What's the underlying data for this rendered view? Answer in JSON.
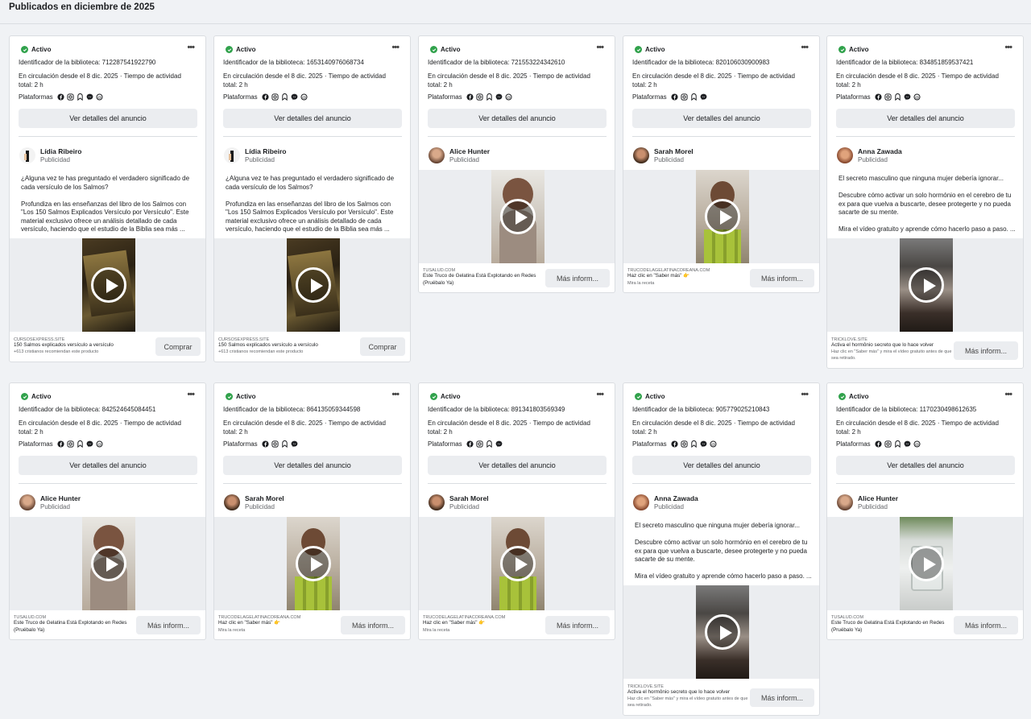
{
  "page": {
    "title": "Publicados en diciembre de 2025"
  },
  "common": {
    "status": "Activo",
    "more": "•••",
    "circulation": "En circulación desde el 8 dic. 2025 · Tiempo de actividad total: 2 h",
    "platforms_label": "Plataformas",
    "details_button": "Ver detalles del anuncio",
    "sponsored": "Publicidad"
  },
  "texts": {
    "salmos": "¿Alguna vez te has preguntado el verdadero significado de cada versículo de los Salmos?\n\nProfundiza en las enseñanzas del libro de los Salmos con \"Los 150 Salmos Explicados Versículo por Versículo\". Este material exclusivo ofrece un análisis detallado de cada versículo, haciendo que el estudio de la Biblia sea más ...",
    "secreto": "El secreto masculino que ninguna mujer debería ignorar...\n\nDescubre cómo activar un solo hormónio en el cerebro de tu ex para que vuelva a buscarte, desee protegerte y no pueda sacarte de su mente.\n\nMira el vídeo gratuito y aprende cómo hacerlo paso a paso. ..."
  },
  "cards": [
    {
      "library_id": "Identificador de la biblioteca: 712287541922790",
      "advertiser": "Lídia Ribeiro",
      "footer": {
        "domain": "CURSOSEXPRESS.SITE",
        "title": "150 Salmos explicados versículo a versículo",
        "desc": "+613 cristianos recomiendan este producto",
        "cta": "Comprar"
      }
    },
    {
      "library_id": "Identificador de la biblioteca: 1653140976068734",
      "advertiser": "Lídia Ribeiro",
      "footer": {
        "domain": "CURSOSEXPRESS.SITE",
        "title": "150 Salmos explicados versículo a versículo",
        "desc": "+613 cristianos recomiendan este producto",
        "cta": "Comprar"
      }
    },
    {
      "library_id": "Identificador de la biblioteca: 721553224342610",
      "advertiser": "Alice Hunter",
      "footer": {
        "domain": "TUSALUD.COM",
        "title": "Este Truco de Gelatina Está Explotando en Redes (Pruébalo Ya)",
        "desc": "",
        "cta": "Más inform..."
      }
    },
    {
      "library_id": "Identificador de la biblioteca: 820106030900983",
      "advertiser": "Sarah Morel",
      "footer": {
        "domain": "TRUCODELAGELATINACOREANA.COM",
        "title": "Haz clic en \"Saber más\" 👉",
        "desc": "Mira la receta",
        "cta": "Más inform..."
      }
    },
    {
      "library_id": "Identificador de la biblioteca: 834851859537421",
      "advertiser": "Anna Zawada",
      "footer": {
        "domain": "TRICKLOVE.SITE",
        "title": "Activa el hormônio secreto que lo hace volver",
        "desc": "Haz clic en \"Saber más\" y mira el vídeo gratuito antes de que sea retirado.",
        "cta": "Más inform..."
      }
    },
    {
      "library_id": "Identificador de la biblioteca: 842524645084451",
      "advertiser": "Alice Hunter",
      "footer": {
        "domain": "TUSALUD.COM",
        "title": "Este Truco de Gelatina Está Explotando en Redes (Pruébalo Ya)",
        "desc": "",
        "cta": "Más inform..."
      }
    },
    {
      "library_id": "Identificador de la biblioteca: 864135059344598",
      "advertiser": "Sarah Morel",
      "footer": {
        "domain": "TRUCODELAGELATINACOREANA.COM",
        "title": "Haz clic en \"Saber más\" 👉",
        "desc": "Mira la receta",
        "cta": "Más inform..."
      }
    },
    {
      "library_id": "Identificador de la biblioteca: 891341803569349",
      "advertiser": "Sarah Morel",
      "footer": {
        "domain": "TRUCODELAGELATINACOREANA.COM",
        "title": "Haz clic en \"Saber más\" 👉",
        "desc": "Mira la receta",
        "cta": "Más inform..."
      }
    },
    {
      "library_id": "Identificador de la biblioteca: 905779025210843",
      "advertiser": "Anna Zawada",
      "footer": {
        "domain": "TRICKLOVE.SITE",
        "title": "Activa el hormônio secreto que lo hace volver",
        "desc": "Haz clic en \"Saber más\" y mira el vídeo gratuito antes de que sea retirado.",
        "cta": "Más inform..."
      }
    },
    {
      "library_id": "Identificador de la biblioteca: 1170230498612635",
      "advertiser": "Alice Hunter",
      "footer": {
        "domain": "TUSALUD.COM",
        "title": "Este Truco de Gelatina Está Explotando en Redes (Pruébalo Ya)",
        "desc": "",
        "cta": "Más inform..."
      }
    }
  ]
}
